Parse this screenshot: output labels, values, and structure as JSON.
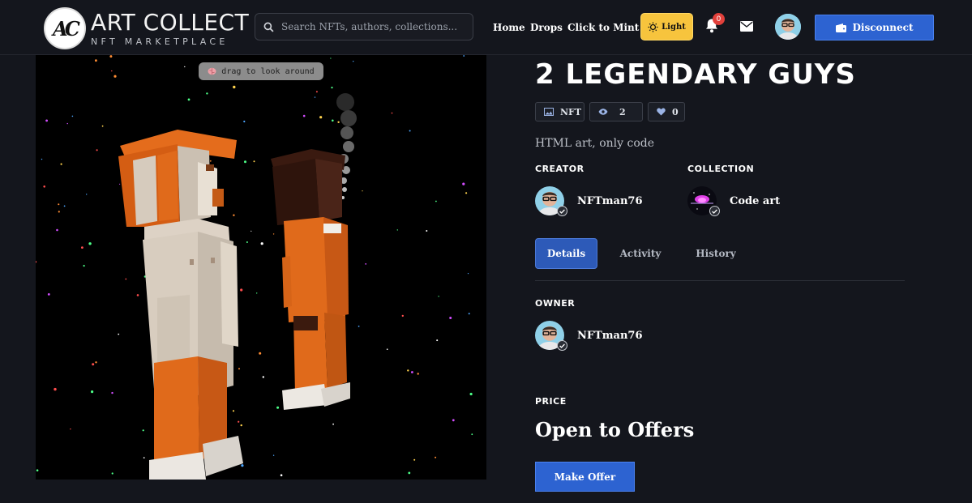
{
  "header": {
    "logo_mark": "AC",
    "logo_title": "ART COLLECT",
    "logo_subtitle": "NFT MARKETPLACE",
    "search_placeholder": "Search NFTs, authors, collections...",
    "nav": [
      "Home",
      "Drops",
      "Click to Mint"
    ],
    "theme_label": "Light",
    "notification_count": "0",
    "disconnect_label": "Disconnect",
    "icons": {
      "search": "search-icon",
      "theme": "sun-icon",
      "notifications": "bell-icon",
      "messages": "envelope-icon",
      "wallet": "wallet-icon"
    }
  },
  "art": {
    "hint": "drag to look around",
    "hint_icon": "brain-icon"
  },
  "nft": {
    "title": "2 LEGENDARY GUYS",
    "type_chip": "NFT",
    "views": "2",
    "likes": "0",
    "description": "HTML art, only code"
  },
  "creator": {
    "label": "CREATOR",
    "name": "NFTman76"
  },
  "collection": {
    "label": "COLLECTION",
    "name": "Code art"
  },
  "tabs": [
    "Details",
    "Activity",
    "History"
  ],
  "owner": {
    "label": "OWNER",
    "name": "NFTman76"
  },
  "price": {
    "label": "PRICE",
    "value": "Open to Offers",
    "button": "Make Offer"
  },
  "colors": {
    "background": "#14161d",
    "primary_button": "#2d63d1",
    "theme_button": "#f7c43d",
    "badge": "#e2403b",
    "figure_orange": "#e06a1b",
    "figure_cream": "#d9cfc1"
  }
}
